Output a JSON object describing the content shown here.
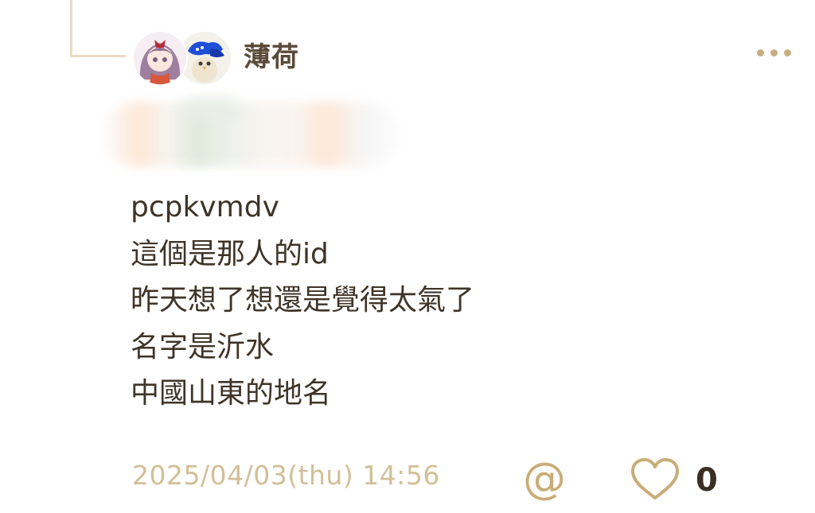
{
  "post": {
    "username": "薄荷",
    "body_lines": [
      "pcpkvmdv",
      "這個是那人的id",
      "昨天想了想還是覺得太氣了",
      "名字是沂水",
      "中國山東的地名"
    ],
    "timestamp": "2025/04/03(thu) 14:56",
    "like_count": "0"
  },
  "icons": {
    "more": "more-dots-icon",
    "mention": "at-mention-icon",
    "like": "heart-icon"
  },
  "colors": {
    "accent": "#c9ac77",
    "username": "#5a4a38",
    "text": "#3f3428",
    "timestamp": "#d2bf98",
    "thread_line": "#e9dcc4"
  },
  "mention_label": "@"
}
